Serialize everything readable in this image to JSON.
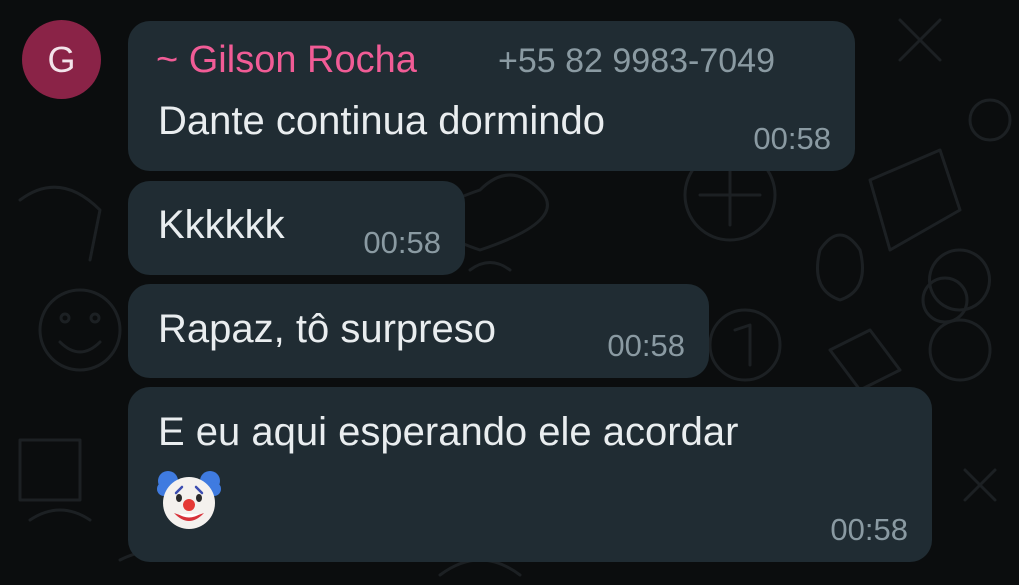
{
  "sender": {
    "avatar_letter": "G",
    "avatar_color": "#8a2347",
    "name": "~ Gilson Rocha",
    "name_color": "#f15c96",
    "phone": "+55 82 9983-7049"
  },
  "messages": [
    {
      "text": "Dante continua dormindo",
      "time": "00:58"
    },
    {
      "text": "Kkkkkk",
      "time": "00:58"
    },
    {
      "text": "Rapaz, tô surpreso",
      "time": "00:58"
    },
    {
      "text": "E eu aqui esperando ele acordar",
      "emoji": "clown-face",
      "time": "00:58"
    }
  ],
  "theme": {
    "background": "#0b0d0e",
    "bubble": "#202c33",
    "text": "#e9edef",
    "timestamp": "#8a9aa2"
  }
}
